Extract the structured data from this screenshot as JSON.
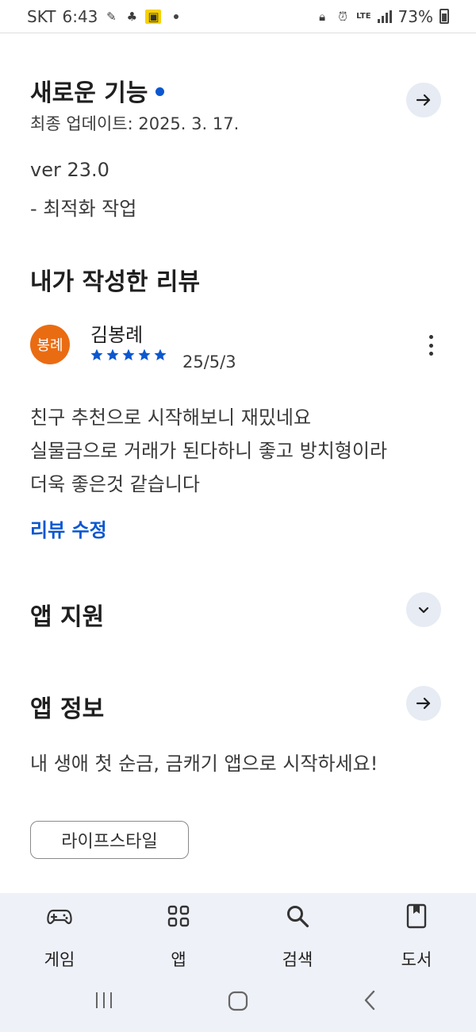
{
  "status_bar": {
    "carrier": "SKT",
    "time": "6:43",
    "battery": "73%",
    "network": "LTE"
  },
  "whats_new": {
    "title": "새로운 기능",
    "updated": "최종 업데이트: 2025. 3. 17.",
    "version": "ver 23.0",
    "notes": "- 최적화 작업"
  },
  "my_review": {
    "title": "내가 작성한 리뷰",
    "avatar_text": "봉례",
    "reviewer": "김봉례",
    "rating": 5,
    "date": "25/5/3",
    "lines": [
      "친구 추천으로 시작해보니 재밌네요",
      "실물금으로 거래가 된다하니 좋고 방치형이라",
      "더욱 좋은것 같습니다"
    ],
    "edit_label": "리뷰 수정"
  },
  "app_support": {
    "title": "앱 지원"
  },
  "app_info": {
    "title": "앱 정보",
    "description": "내 생애 첫 순금, 금캐기 앱으로 시작하세요!",
    "category_chip": "라이프스타일"
  },
  "bottom_nav": {
    "items": [
      {
        "label": "게임",
        "icon": "gamepad-icon"
      },
      {
        "label": "앱",
        "icon": "apps-grid-icon"
      },
      {
        "label": "검색",
        "icon": "search-icon"
      },
      {
        "label": "도서",
        "icon": "book-icon"
      }
    ]
  },
  "colors": {
    "accent_blue": "#0b57d0",
    "avatar_orange": "#ea6c12",
    "button_bg": "#e6ebf4",
    "nav_bg": "#eef1f7"
  }
}
